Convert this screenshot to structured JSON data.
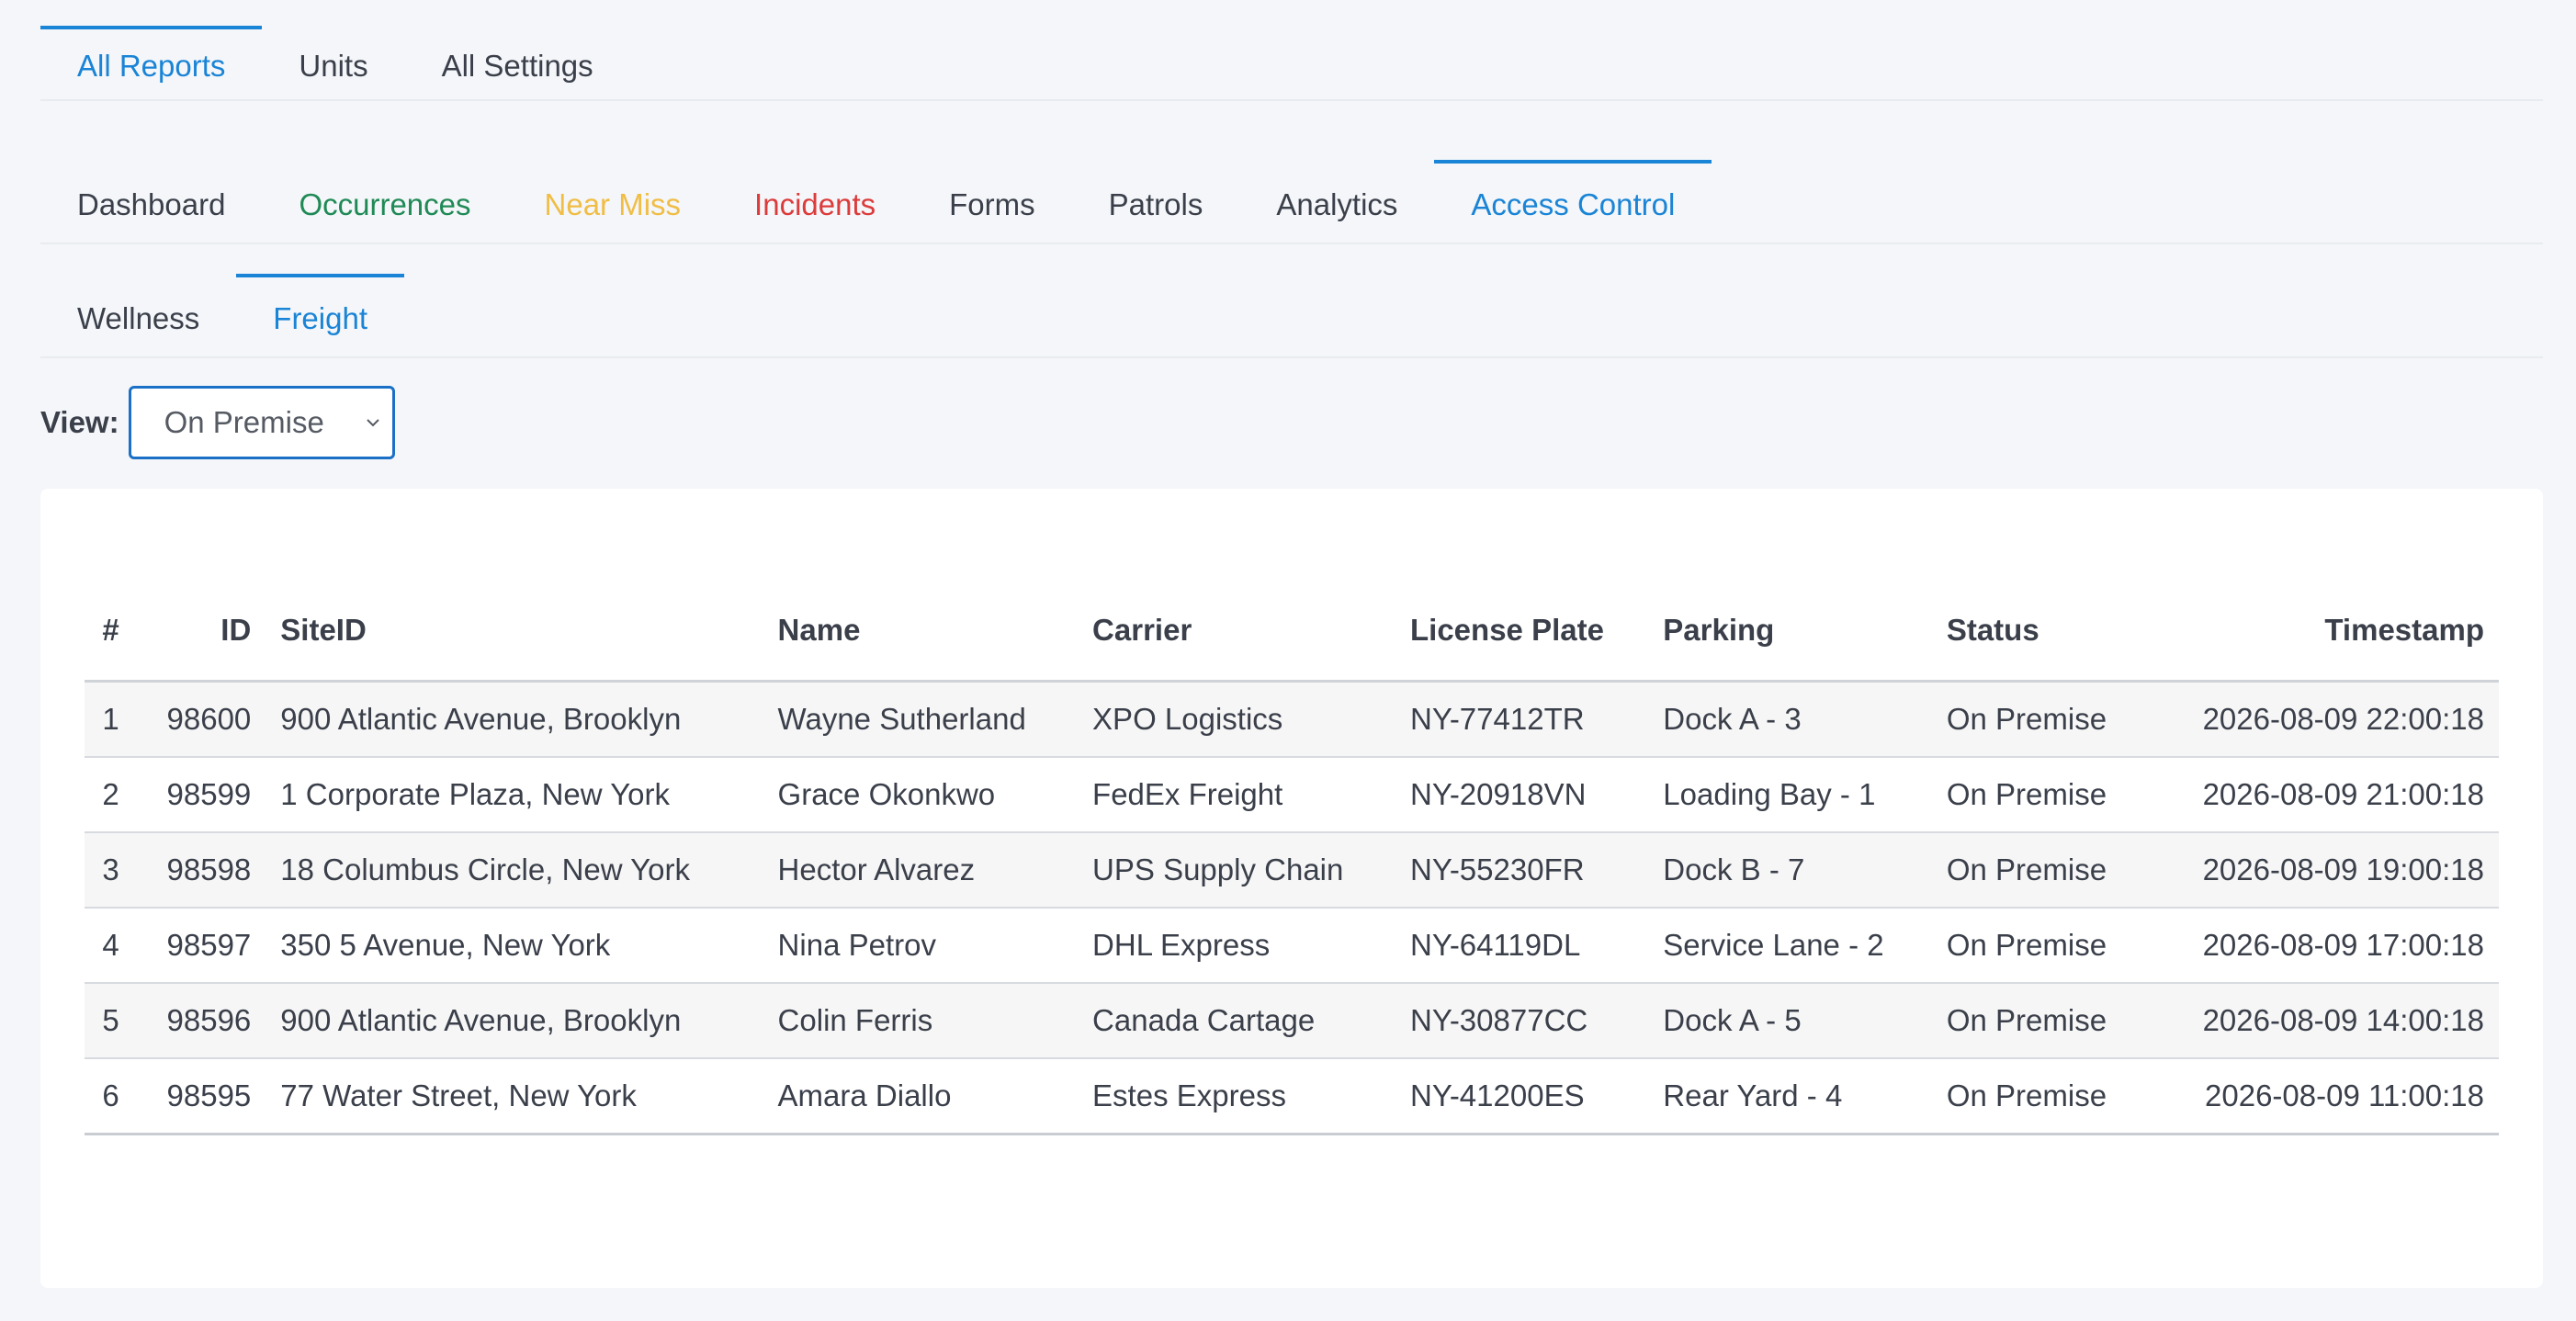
{
  "tabs_top": [
    {
      "label": "All Reports",
      "active": true
    },
    {
      "label": "Units",
      "active": false
    },
    {
      "label": "All Settings",
      "active": false
    }
  ],
  "tabs_reports": [
    {
      "label": "Dashboard"
    },
    {
      "label": "Occurrences",
      "color": "#1f8a56"
    },
    {
      "label": "Near Miss",
      "color": "#f0bd45"
    },
    {
      "label": "Incidents",
      "color": "#dc3b3b"
    },
    {
      "label": "Forms"
    },
    {
      "label": "Patrols"
    },
    {
      "label": "Analytics"
    },
    {
      "label": "Access Control",
      "active": true
    }
  ],
  "tabs_access": [
    {
      "label": "Wellness"
    },
    {
      "label": "Freight",
      "active": true
    }
  ],
  "view": {
    "label": "View:",
    "selected": "On Premise"
  },
  "table": {
    "headers": [
      "#",
      "ID",
      "SiteID",
      "Name",
      "Carrier",
      "License Plate",
      "Parking",
      "Status",
      "Timestamp"
    ],
    "rows": [
      {
        "n": "1",
        "id": "98600",
        "site": "900 Atlantic Avenue, Brooklyn",
        "name": "Wayne Sutherland",
        "carrier": "XPO Logistics",
        "plate": "NY-77412TR",
        "parking": "Dock A - 3",
        "status": "On Premise",
        "timestamp": "2026-08-09 22:00:18"
      },
      {
        "n": "2",
        "id": "98599",
        "site": "1 Corporate Plaza, New York",
        "name": "Grace Okonkwo",
        "carrier": "FedEx Freight",
        "plate": "NY-20918VN",
        "parking": "Loading Bay - 1",
        "status": "On Premise",
        "timestamp": "2026-08-09 21:00:18"
      },
      {
        "n": "3",
        "id": "98598",
        "site": "18 Columbus Circle, New York",
        "name": "Hector Alvarez",
        "carrier": "UPS Supply Chain",
        "plate": "NY-55230FR",
        "parking": "Dock B - 7",
        "status": "On Premise",
        "timestamp": "2026-08-09 19:00:18"
      },
      {
        "n": "4",
        "id": "98597",
        "site": "350 5 Avenue, New York",
        "name": "Nina Petrov",
        "carrier": "DHL Express",
        "plate": "NY-64119DL",
        "parking": "Service Lane - 2",
        "status": "On Premise",
        "timestamp": "2026-08-09 17:00:18"
      },
      {
        "n": "5",
        "id": "98596",
        "site": "900 Atlantic Avenue, Brooklyn",
        "name": "Colin Ferris",
        "carrier": "Canada Cartage",
        "plate": "NY-30877CC",
        "parking": "Dock A - 5",
        "status": "On Premise",
        "timestamp": "2026-08-09 14:00:18"
      },
      {
        "n": "6",
        "id": "98595",
        "site": "77 Water Street, New York",
        "name": "Amara Diallo",
        "carrier": "Estes Express",
        "plate": "NY-41200ES",
        "parking": "Rear Yard - 4",
        "status": "On Premise",
        "timestamp": "2026-08-09 11:00:18"
      }
    ]
  },
  "colors": {
    "accent": "#1a84d6",
    "green": "#1f8a56",
    "yellow": "#f0bd45",
    "red": "#dc3b3b"
  }
}
